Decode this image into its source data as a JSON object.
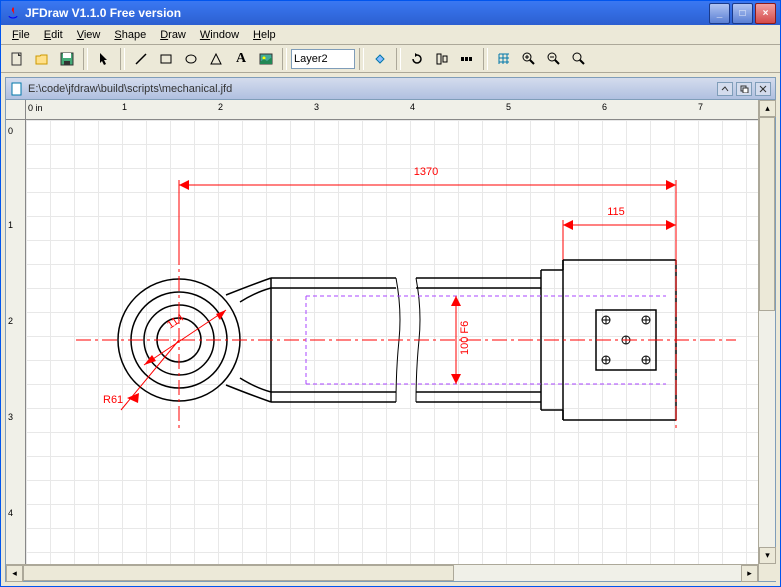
{
  "titlebar": {
    "text": "JFDraw V1.1.0 Free version"
  },
  "menu": {
    "file": "File",
    "edit": "Edit",
    "view": "View",
    "shape": "Shape",
    "draw": "Draw",
    "window": "Window",
    "help": "Help"
  },
  "toolbar": {
    "layer": "Layer2"
  },
  "document": {
    "path": "E:\\code\\jfdraw\\build\\scripts\\mechanical.jfd",
    "ruler_unit": "in"
  },
  "ruler_h": {
    "ticks": [
      0,
      1,
      2,
      3,
      4,
      5,
      6,
      7
    ]
  },
  "ruler_v": {
    "ticks": [
      0,
      1,
      2,
      3,
      4
    ]
  },
  "dimensions": {
    "dim1": "1370",
    "dim2": "115",
    "dim3": "114",
    "dim4": "R61",
    "dim5": "100 F6"
  }
}
